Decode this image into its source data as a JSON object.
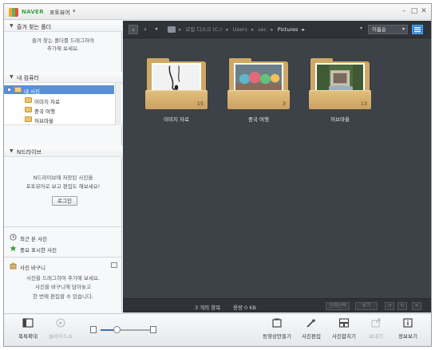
{
  "window": {
    "brand": "NAVER",
    "app_name": "포토뷰어",
    "controls": {
      "minimize": "–",
      "maximize": "□",
      "close": "✕"
    }
  },
  "left_panel": {
    "favorites": {
      "title": "즐겨 찾는 폴더",
      "hint_line1": "즐겨 찾는 폴더를 드래그하여",
      "hint_line2": "추가해 보세요."
    },
    "my_computer": {
      "title": "내 컴퓨터",
      "root": "내 사진",
      "folders": [
        "이미지 자료",
        "중국 여행",
        "허브마을"
      ]
    },
    "ndrive": {
      "title": "N드라이브",
      "hint_line1": "N드라이브에 저장된 사진을",
      "hint_line2": "포토뷰어로 보고 편집도 해보세요!",
      "login_label": "로그인"
    },
    "recent_label": "최근 본 사진",
    "important_label": "중요 표시한 사진",
    "basket": {
      "title": "사진 바구니",
      "hint_line1": "사진을 드래그하여 추가해 보세요.",
      "hint_line2": "사진을 바구니에 담아놓고",
      "hint_line3": "한 번에 편집할 수 있습니다."
    }
  },
  "toolbar": {
    "breadcrumb": [
      "로컬 디스크 (C:)",
      "Users",
      "sec",
      "Pictures"
    ],
    "sort_label": "이름순"
  },
  "folders": [
    {
      "name": "이미지 자료",
      "count": "15",
      "thumb": "earphones-photo"
    },
    {
      "name": "중국 여행",
      "count": "3",
      "thumb": "stuffed-toys-photo"
    },
    {
      "name": "허브마을",
      "count": "13",
      "thumb": "garden-fountain-photo"
    }
  ],
  "status": {
    "count_text": "3 개의 항목",
    "size_text": "용량 0 KB",
    "btn_select_all": "전체선택",
    "btn_slideshow": "보기"
  },
  "bottom_toolbar": {
    "collapse_label": "목록확대",
    "slideshow_label": "슬라이드쇼",
    "movie_label": "동영상만들기",
    "edit_label": "사진편집",
    "merge_label": "사진합치기",
    "send_label": "보내기",
    "info_label": "정보보기"
  },
  "colors": {
    "main_bg": "#3d4148",
    "selection": "#5a8fd8",
    "folder": "#cfa866",
    "accent": "#2d86d6"
  }
}
